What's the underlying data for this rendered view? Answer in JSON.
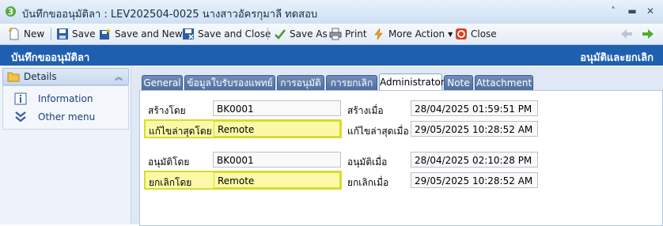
{
  "window": {
    "title": "บันทึกขออนุมัติลา : LEV202504-0025 นางสาวอัครกุมาลี ทดสอบ",
    "controls": [
      "˄",
      "▬",
      "✕"
    ]
  },
  "toolbar": {
    "new": "New",
    "save": "Save",
    "save_new": "Save and New",
    "save_close": "Save and Close",
    "save_as": "Save As",
    "print": "Print",
    "more_action": "More Action",
    "close": "Close"
  },
  "header": {
    "title": "บันทึกขออนุมัติลา",
    "right": "อนุมัติและยกเลิก"
  },
  "sidebar": {
    "group": "Details",
    "items": [
      {
        "label": "Information",
        "icon": "info-icon"
      },
      {
        "label": "Other menu",
        "icon": "double-chevron-down-icon"
      }
    ]
  },
  "tabs": [
    "General",
    "ข้อมูลใบรับรองแพทย์",
    "การอนุมัติ",
    "การยกเลิก",
    "Administrator",
    "Note",
    "Attachment"
  ],
  "active_tab": "Administrator",
  "form": {
    "created_by_label": "สร้างโดย",
    "created_by": "BK0001",
    "created_at_label": "สร้างเมื่อ",
    "created_at": "28/04/2025 01:59:51 PM",
    "modified_by_label": "แก้ไขล่าสุดโดย",
    "modified_by": "Remote",
    "modified_at_label": "แก้ไขล่าสุดเมื่อ",
    "modified_at": "29/05/2025 10:28:52 AM",
    "approved_by_label": "อนุมัติโดย",
    "approved_by": "BK0001",
    "approved_at_label": "อนุมัติเมื่อ",
    "approved_at": "28/04/2025 02:10:28 PM",
    "cancelled_by_label": "ยกเลิกโดย",
    "cancelled_by": "Remote",
    "cancelled_at_label": "ยกเลิกเมื่อ",
    "cancelled_at": "29/05/2025 10:28:52 AM"
  },
  "colors": {
    "header_bar": "#1f5fb0",
    "highlight_fill": "#fbf9a8",
    "highlight_border": "#d7dc2f",
    "tab_inactive": "#5a7aab"
  }
}
